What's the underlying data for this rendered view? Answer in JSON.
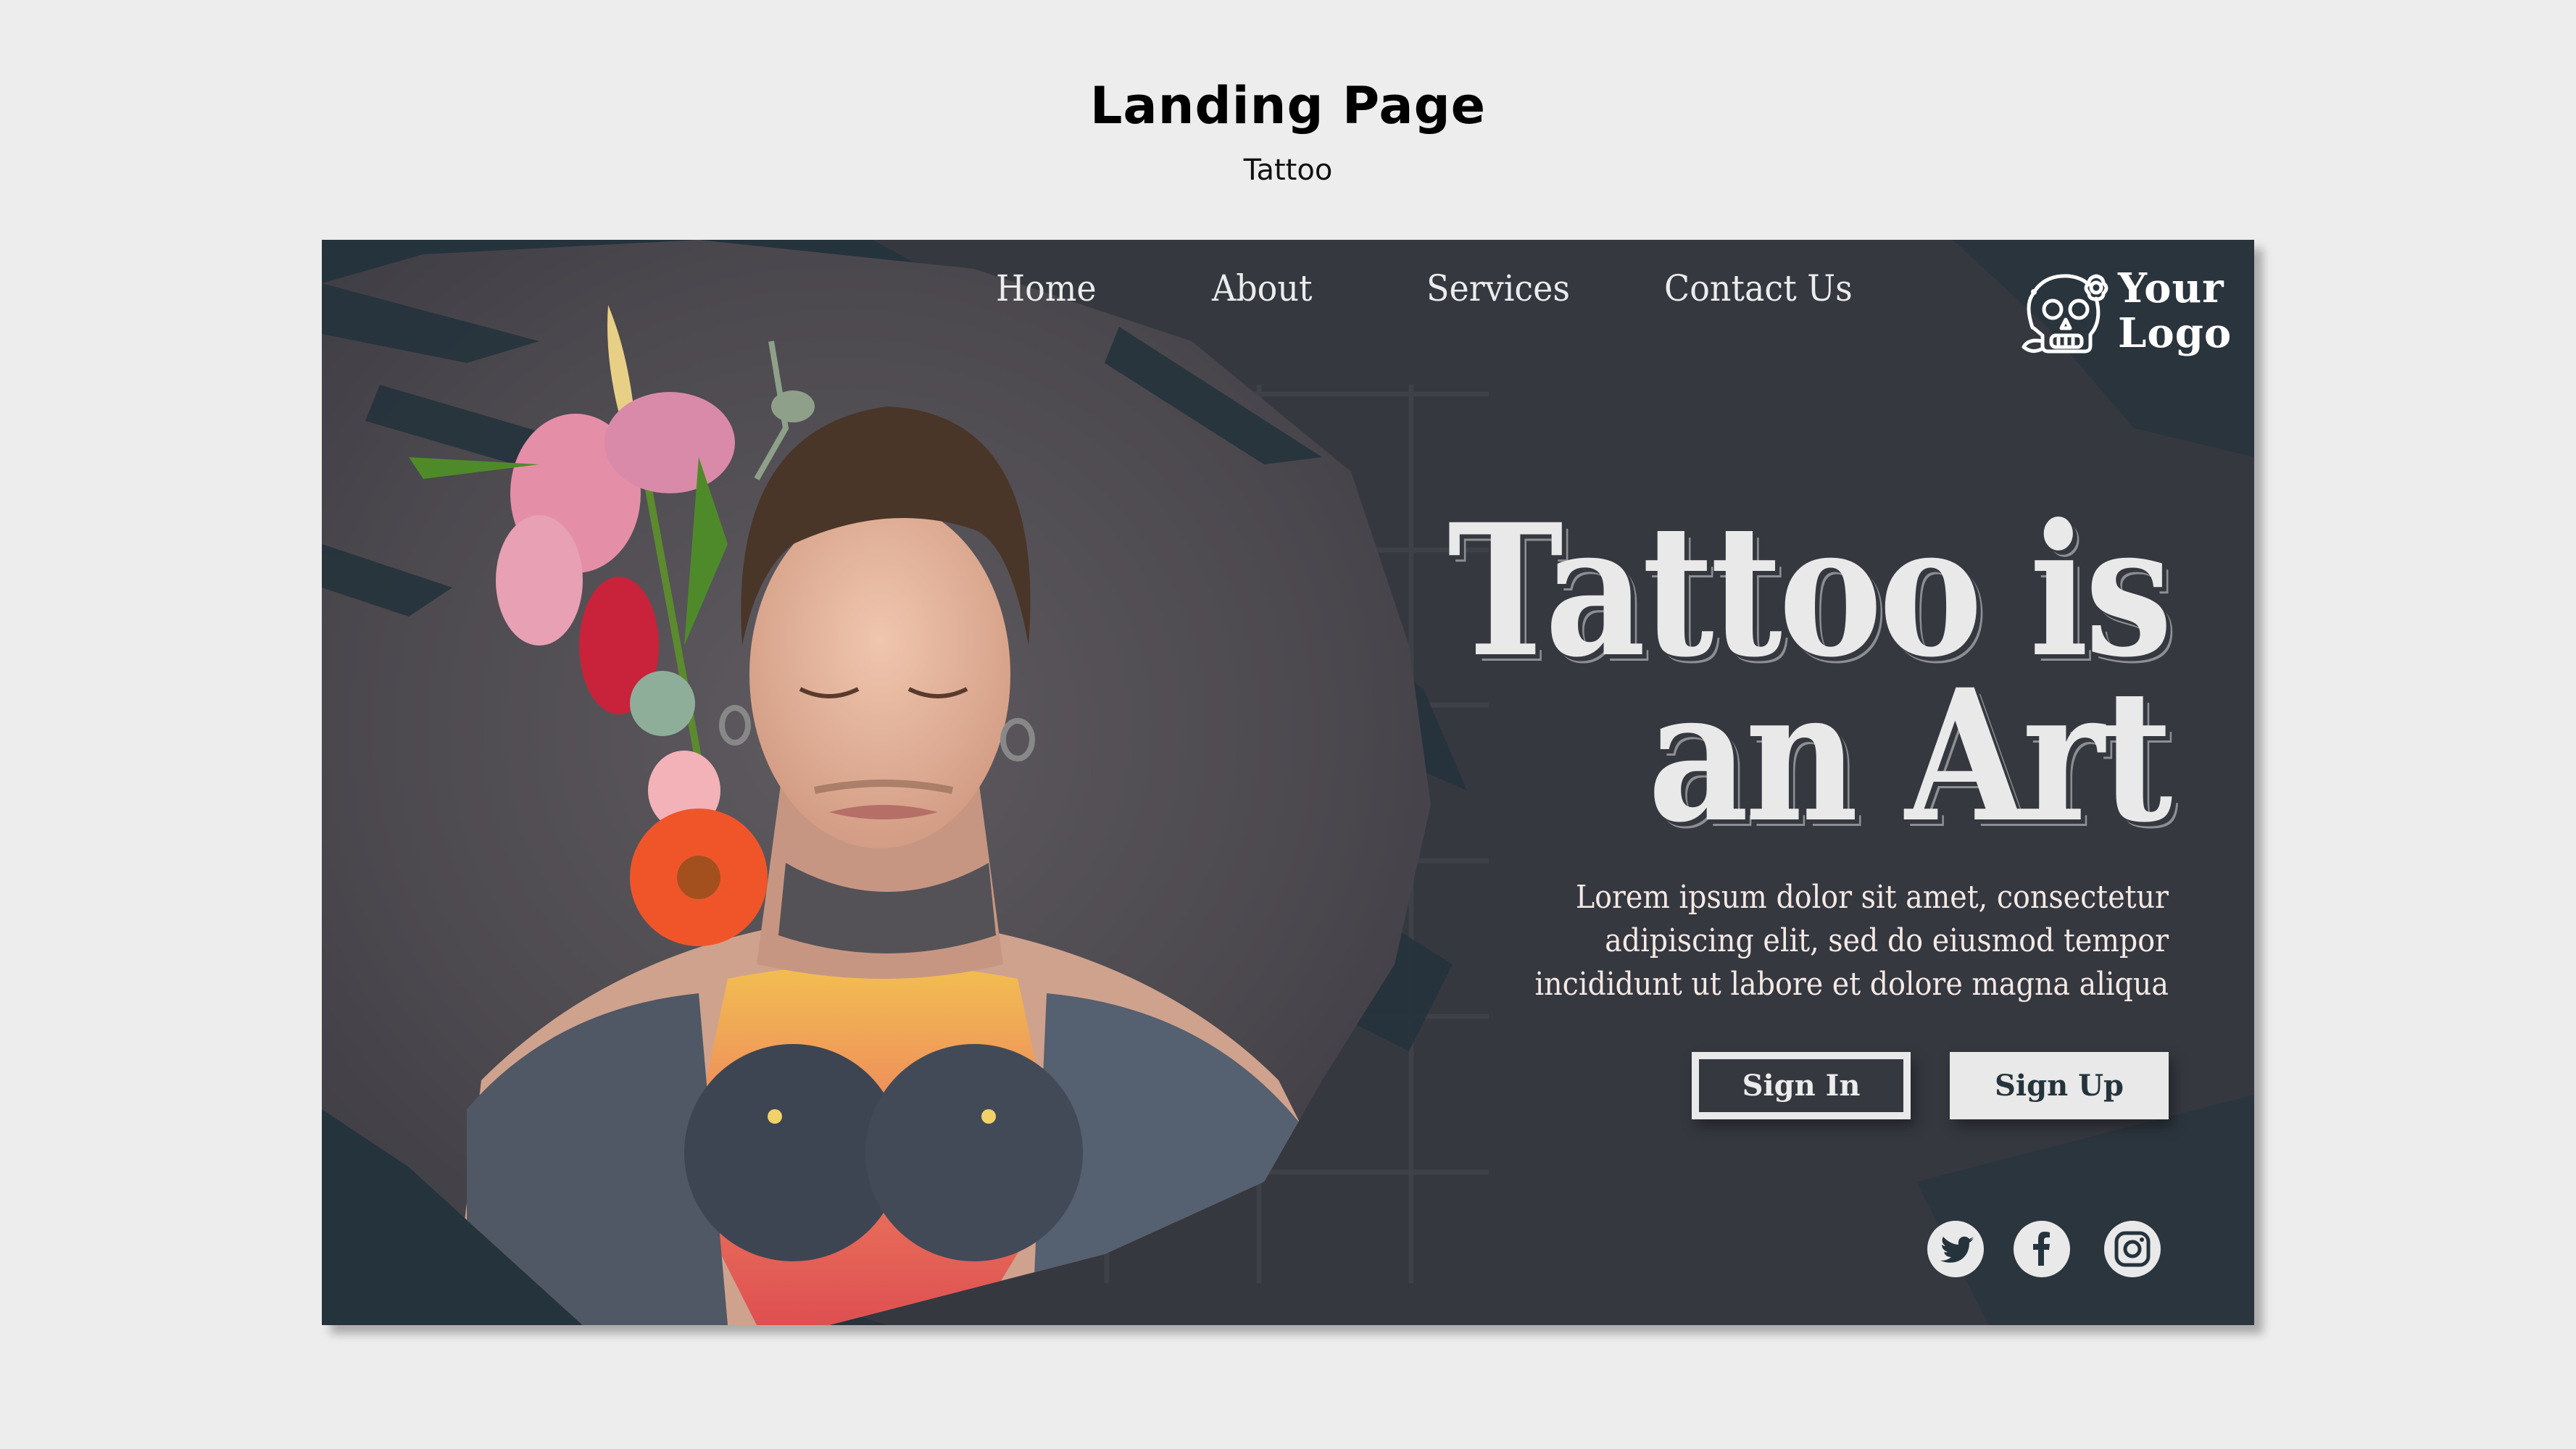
{
  "header": {
    "title": "Landing Page",
    "subtitle": "Tattoo"
  },
  "hero": {
    "nav": [
      {
        "label": "Home"
      },
      {
        "label": "About"
      },
      {
        "label": "Services"
      },
      {
        "label": "Contact Us"
      }
    ],
    "logo": {
      "icon": "sugar-skull-icon",
      "line1": "Your",
      "line2": "Logo"
    },
    "headline": {
      "line1": "Tattoo is",
      "line2": "an Art"
    },
    "body_lines": [
      "Lorem ipsum dolor sit amet, consectetur",
      "adipiscing elit, sed do eiusmod tempor",
      "incididunt ut labore et dolore magna aliqua"
    ],
    "buttons": {
      "sign_in": "Sign In",
      "sign_up": "Sign Up"
    },
    "social": [
      {
        "name": "twitter",
        "icon": "twitter-icon"
      },
      {
        "name": "facebook",
        "icon": "facebook-icon"
      },
      {
        "name": "instagram",
        "icon": "instagram-icon"
      }
    ],
    "image_alt": "Man with closed eyes, flowers behind ear, tattooed neck and chest"
  },
  "colors": {
    "page_bg": "#ededed",
    "card_bg": "#363840",
    "brush_dark": "#25333c",
    "text_light": "#e9e9e9",
    "text_warm": "#f4e9e4"
  }
}
